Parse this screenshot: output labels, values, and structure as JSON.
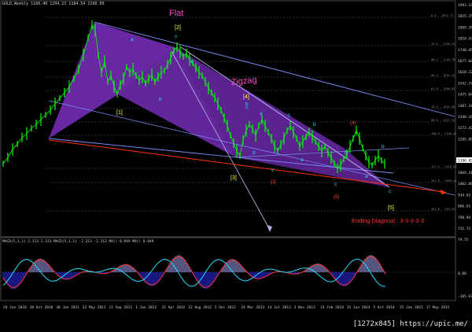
{
  "window": {
    "title": "GOLD,Weekly",
    "ohlc": "1189.40 1204.23 1184.54 1190.09"
  },
  "indicator": {
    "header": "MACD(5,1,1) 2.313 2.313  MACD(5,1,1) -2.313 -2.313  MA() 0.949  MA() 0.949"
  },
  "price_axis": {
    "labels": [
      "1993.24",
      "1925.35",
      "1869.26",
      "1810.43",
      "1740.85",
      "1677.60",
      "1610.22",
      "1542.74",
      "1475.04",
      "1407.34",
      "1340.16",
      "1272.42",
      "1205.89",
      "1190.09",
      "1137.12",
      "1069.41",
      "1002.06",
      "934.62",
      "866.61",
      "798.94",
      "731.72"
    ],
    "current": "1190.09"
  },
  "indicator_axis": {
    "labels": [
      "79.55",
      "0.00",
      "-105.6787"
    ]
  },
  "time_axis": {
    "labels": [
      "20 Jun 2010",
      "10 Oct 2010",
      "30 Jan 2011",
      "22 May 2011",
      "11 Sep 2011",
      "1 Jan 2012",
      "22 Apr 2012",
      "12 Aug 2012",
      "2 Dec 2012",
      "24 Mar 2013",
      "14 Jul 2013",
      "3 Nov 2013",
      "23 Feb 2014",
      "15 Jun 2014",
      "5 Oct 2014",
      "25 Jan 2015",
      "17 May 2015"
    ]
  },
  "fib_levels": [
    "0.0 - 1923.72",
    "23.6 - 1796.24",
    "38.2 - 1716.70",
    "50.0 - 1653.23",
    "61.8 - 1588.83",
    "76.4 - 1503.60",
    "88.6 - 1427.34",
    "100.0 - 1346.46",
    "127.2 - 1210.50",
    "161.8 - 1050.44",
    "261.8 - 923.53"
  ],
  "annotations": {
    "flat": "Flat",
    "zigzag": "Zigzag",
    "ending": "Ending Diagonal : 3-3-3-3-3",
    "w2": "[2]",
    "w1": "[1]",
    "w3": "[3]",
    "w4": "[4]",
    "w5": "[5]",
    "w3_red": "[3]",
    "w4_red": "(4)",
    "w5_red": "(5)",
    "a_labels": [
      "a",
      "a",
      "a",
      "a",
      "a"
    ],
    "b_labels": [
      "b",
      "b",
      "b",
      "b",
      "b",
      "b"
    ],
    "c_labels": [
      "c",
      "c",
      "c",
      "c",
      "c",
      "c"
    ]
  },
  "watermark": "[1272x845] https://upic.me/",
  "colors": {
    "background": "#000000",
    "candles": "#00ff00",
    "pattern_fill": "#7a2fc0",
    "channel": "#7f8fff",
    "trend_red": "#ff3300",
    "flat_label": "#ff44cc",
    "wave_yellow": "#ffff33",
    "wave_cyan": "#22ddff"
  }
}
